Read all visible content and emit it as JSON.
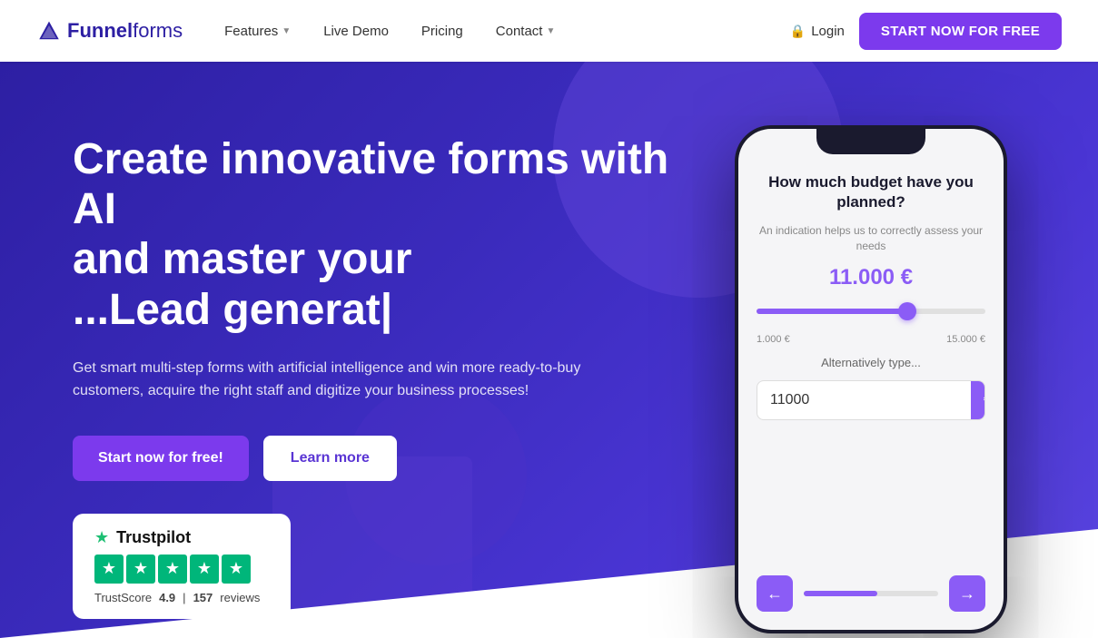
{
  "navbar": {
    "logo_funnel": "Funnel",
    "logo_forms": "forms",
    "nav_items": [
      {
        "label": "Features",
        "has_chevron": true
      },
      {
        "label": "Live Demo",
        "has_chevron": false
      },
      {
        "label": "Pricing",
        "has_chevron": false
      },
      {
        "label": "Contact",
        "has_chevron": true
      }
    ],
    "login_label": "Login",
    "start_btn_label": "START NOW FOR FREE"
  },
  "hero": {
    "title": "Create innovative forms with AI\nand master your\n...Lead generat|",
    "title_line1": "Create innovative forms with AI",
    "title_line2": "and master your",
    "title_line3": "...Lead generat|",
    "subtitle": "Get smart multi-step forms with artificial intelligence and win more ready-to-buy customers, acquire the right staff and digitize your business processes!",
    "btn_primary_label": "Start now for free!",
    "btn_secondary_label": "Learn more"
  },
  "trustpilot": {
    "logo": "Trustpilot",
    "trust_score_label": "TrustScore",
    "score": "4.9",
    "separator": "|",
    "reviews_count": "157",
    "reviews_label": "reviews"
  },
  "phone_card": {
    "question": "How much budget have you planned?",
    "hint": "An indication helps us to correctly assess your needs",
    "amount": "11.000 €",
    "slider_min": "1.000 €",
    "slider_max": "15.000 €",
    "alt_label": "Alternatively type...",
    "input_value": "11000",
    "currency_symbol": "€"
  }
}
